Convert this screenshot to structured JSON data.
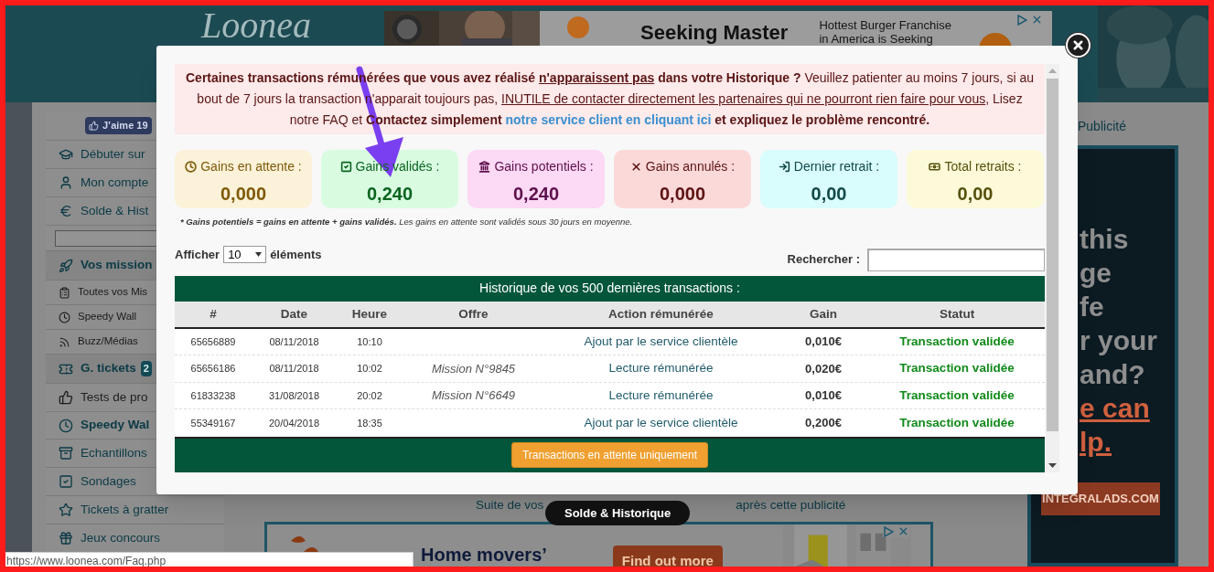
{
  "background": {
    "logo": "Loonea",
    "top_ad": {
      "headline": "Seeking Master",
      "lines": [
        "Hottest Burger Franchise",
        "in America is Seeking"
      ]
    },
    "like_button": "J’aime 19",
    "sidebar": [
      {
        "kind": "main",
        "label": "Débuter sur"
      },
      {
        "kind": "main",
        "label": "Mon compte"
      },
      {
        "kind": "main",
        "label": "Solde & Hist"
      },
      {
        "kind": "field"
      },
      {
        "kind": "section",
        "label": "Vos mission"
      },
      {
        "kind": "sub",
        "label": "Toutes vos Mis"
      },
      {
        "kind": "sub",
        "label": "Speedy Wall"
      },
      {
        "kind": "sub",
        "label": "Buzz/Médias"
      },
      {
        "kind": "section",
        "label": "G. tickets",
        "badge": "2"
      },
      {
        "kind": "grey",
        "label": "Tests de pro"
      },
      {
        "kind": "bold",
        "label": "Speedy Wal"
      },
      {
        "kind": "main",
        "label": "Echantillons"
      },
      {
        "kind": "main",
        "label": "Sondages"
      },
      {
        "kind": "main",
        "label": "Tickets à gratter"
      },
      {
        "kind": "main",
        "label": "Jeux concours"
      }
    ],
    "publicity_link": "Publicité",
    "side_ad": {
      "lines": [
        "this",
        "ge",
        "fe",
        "r your",
        "and?"
      ],
      "accent_lines": [
        "e can",
        "lp."
      ],
      "button": "INTEGRALADS.COM"
    },
    "continue_text": [
      "Suite de vos",
      "après cette publicité"
    ],
    "bottom_ad": {
      "headline": "Home movers’",
      "button": "Find out more"
    }
  },
  "modal": {
    "notice": [
      {
        "kind": "bold",
        "text": "Certaines transactions rémunérées que vous avez réalisé "
      },
      {
        "kind": "bold-underline",
        "text": "n'apparaissent pas"
      },
      {
        "kind": "bold",
        "text": " dans votre Historique ?"
      },
      {
        "kind": "normal",
        "text": " Veuillez patienter au moins 7 jours, si au bout de 7 jours la transaction n'apparait toujours pas, "
      },
      {
        "kind": "underline",
        "text": "INUTILE de contacter directement les partenaires qui ne pourront rien faire pour vous"
      },
      {
        "kind": "normal",
        "text": ", Lisez notre FAQ et "
      },
      {
        "kind": "bold",
        "text": "Contactez simplement "
      },
      {
        "kind": "link",
        "text": "notre service client en cliquant ici"
      },
      {
        "kind": "bold",
        "text": " et expliquez le problème rencontré."
      }
    ],
    "stats": [
      {
        "label": "Gains en attente :",
        "value": "0,000",
        "color": "#7d5a08"
      },
      {
        "label": "Gains validés :",
        "value": "0,240",
        "color": "#0b6420"
      },
      {
        "label": "Gains potentiels :",
        "value": "0,240",
        "color": "#5e0f4c"
      },
      {
        "label": "Gains annulés :",
        "value": "0,000",
        "color": "#5c1212"
      },
      {
        "label": "Dernier retrait :",
        "value": "0,00",
        "color": "#124848"
      },
      {
        "label": "Total retraits :",
        "value": "0,00",
        "color": "#55500c"
      }
    ],
    "footnote": {
      "bold_part": "* Gains potentiels = gains en attente + gains validés.",
      "rest": " Les gains en attente sont validés sous 30 jours en moyenne."
    },
    "length": {
      "before": "Afficher",
      "value": "10",
      "after": "éléments"
    },
    "search_label": "Rechercher :",
    "table": {
      "title": "Historique de vos 500 dernières transactions :",
      "columns": [
        "#",
        "Date",
        "Heure",
        "Offre",
        "Action rémunérée",
        "Gain",
        "Statut"
      ],
      "rows": [
        {
          "id": "65656889",
          "date": "08/11/2018",
          "time": "10:10",
          "action": "Ajout par le service clientèle",
          "gain": "0,010€",
          "status": "Transaction validée"
        },
        {
          "id": "65656186",
          "date": "08/11/2018",
          "time": "10:02",
          "offer": "Mission N°9845",
          "action": "Lecture rémunérée",
          "gain": "0,020€",
          "status": "Transaction validée"
        },
        {
          "id": "61833238",
          "date": "31/08/2018",
          "time": "20:02",
          "offer": "Mission N°6649",
          "action": "Lecture rémunérée",
          "gain": "0,010€",
          "status": "Transaction validée"
        },
        {
          "id": "55349167",
          "date": "20/04/2018",
          "time": "18:35",
          "action": "Ajout par le service clientèle",
          "gain": "0,200€",
          "status": "Transaction validée"
        }
      ],
      "footer_button": "Transactions en attente uniquement"
    }
  },
  "page_tab": "Solde & Historique",
  "status_url": "https://www.loonea.com/Faq.php"
}
